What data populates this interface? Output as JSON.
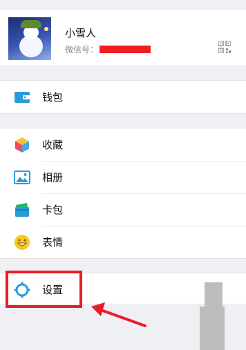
{
  "profile": {
    "nickname": "小雪人",
    "wechat_id_label": "微信号："
  },
  "menu": {
    "wallet": "钱包",
    "favorites": "收藏",
    "album": "相册",
    "cards": "卡包",
    "stickers": "表情",
    "settings": "设置"
  },
  "colors": {
    "highlight": "#ea1c25",
    "redaction": "#f01d20",
    "icon_blue": "#2a9bd9"
  },
  "icons": [
    "qr-code-icon",
    "wallet-icon",
    "favorites-icon",
    "album-icon",
    "cards-icon",
    "stickers-icon",
    "settings-gear-icon"
  ]
}
